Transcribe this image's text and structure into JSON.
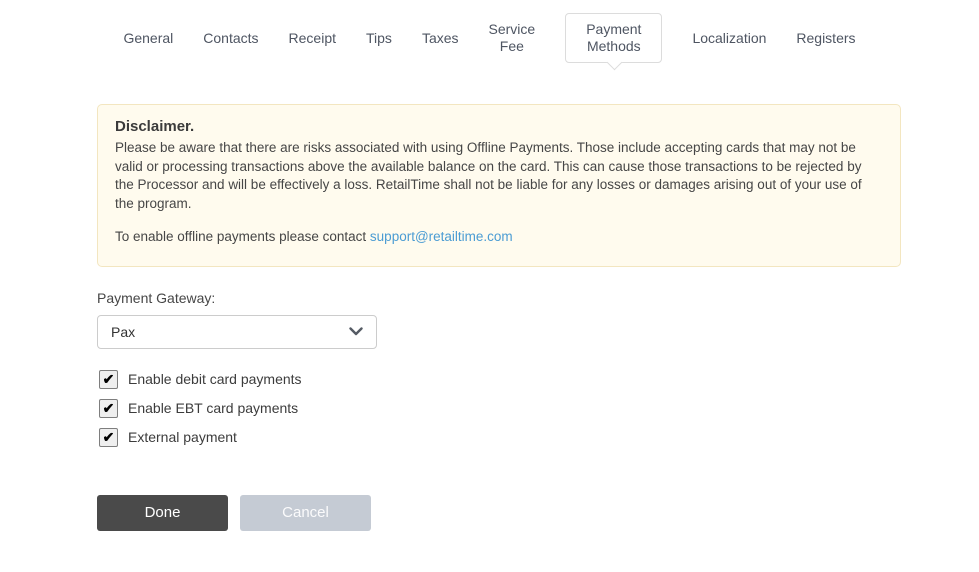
{
  "tabs": {
    "items": [
      {
        "label": "General",
        "active": false
      },
      {
        "label": "Contacts",
        "active": false
      },
      {
        "label": "Receipt",
        "active": false
      },
      {
        "label": "Tips",
        "active": false
      },
      {
        "label": "Taxes",
        "active": false
      },
      {
        "label": "Service\nFee",
        "active": false
      },
      {
        "label": "Payment\nMethods",
        "active": true
      },
      {
        "label": "Localization",
        "active": false
      },
      {
        "label": "Registers",
        "active": false
      }
    ]
  },
  "disclaimer": {
    "title": "Disclaimer.",
    "body": "Please be aware that there are risks associated with using Offline Payments. Those include accepting cards that may not be valid or processing transactions above the available balance on the card. This can cause those transactions to be rejected by the Processor and will be effectively a loss. RetailTime shall not be liable for any losses or damages arising out of your use of the program.",
    "contact_prefix": "To enable offline payments please contact ",
    "contact_email": "support@retailtime.com",
    "background_color": "#fffbee",
    "border_color": "#f3e6c0",
    "link_color": "#4b9cd3"
  },
  "form": {
    "gateway_label": "Payment Gateway:",
    "gateway_value": "Pax",
    "checkboxes": [
      {
        "label": "Enable debit card payments",
        "checked": true
      },
      {
        "label": "Enable EBT card payments",
        "checked": true
      },
      {
        "label": "External payment",
        "checked": true
      }
    ]
  },
  "actions": {
    "done_label": "Done",
    "cancel_label": "Cancel",
    "done_color": "#4a4a4a",
    "cancel_color": "#c5cbd4"
  },
  "icons": {
    "check": "✔"
  }
}
